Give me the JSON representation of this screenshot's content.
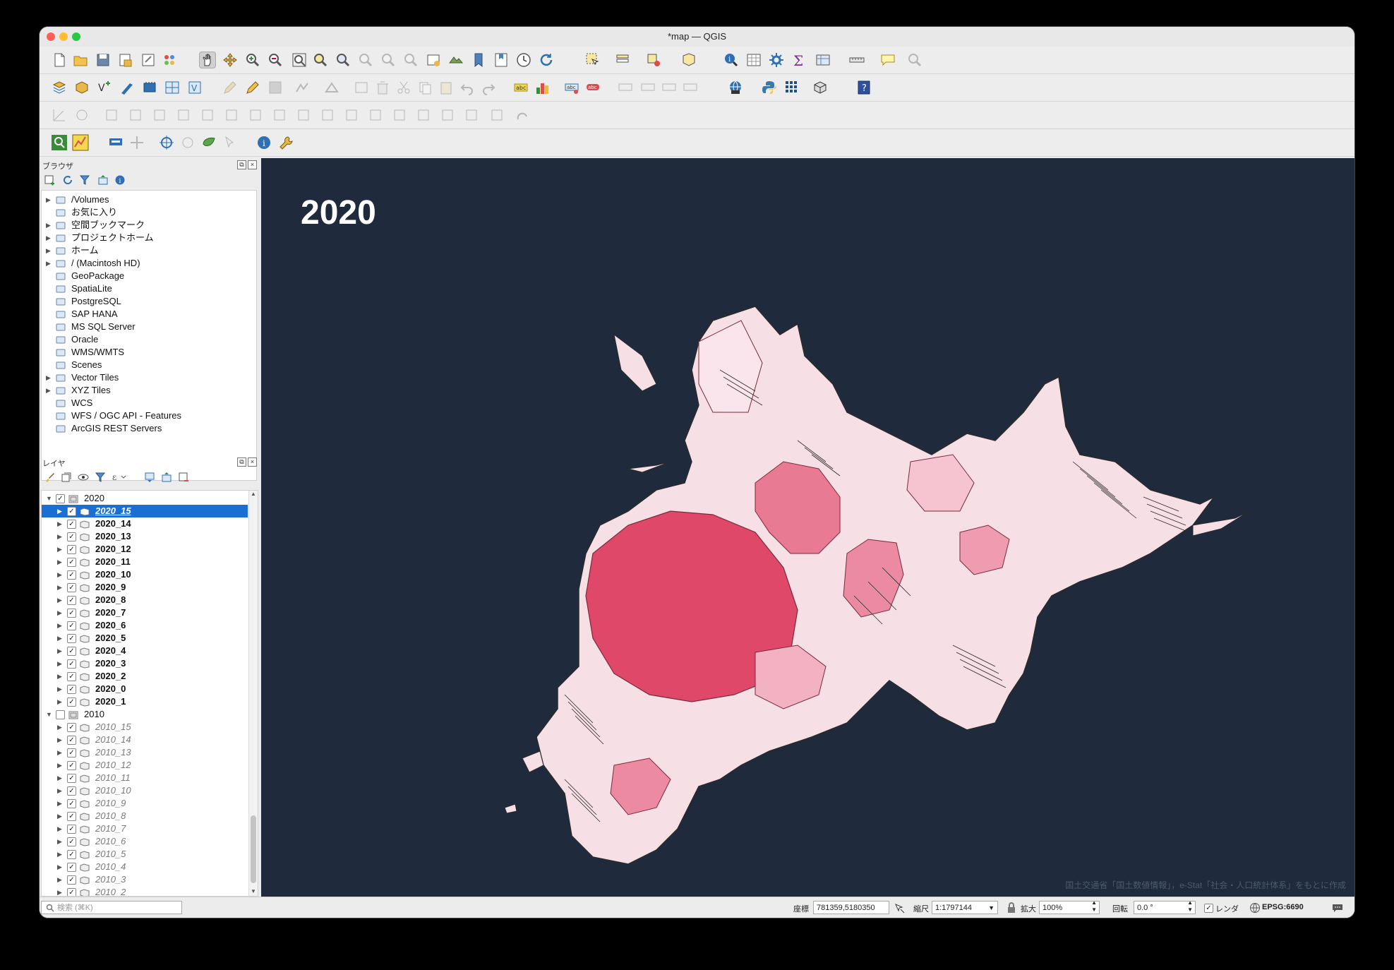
{
  "window": {
    "title": "*map — QGIS"
  },
  "browser": {
    "title": "ブラウザ",
    "items": [
      {
        "label": "/Volumes",
        "icon": "folder-icon",
        "expandable": true
      },
      {
        "label": "お気に入り",
        "icon": "star-icon",
        "expandable": false
      },
      {
        "label": "空間ブックマーク",
        "icon": "bookmark-icon",
        "expandable": true
      },
      {
        "label": "プロジェクトホーム",
        "icon": "project-home-icon",
        "expandable": true
      },
      {
        "label": "ホーム",
        "icon": "home-icon",
        "expandable": true
      },
      {
        "label": "/ (Macintosh HD)",
        "icon": "folder-icon",
        "expandable": true
      },
      {
        "label": "GeoPackage",
        "icon": "geopackage-icon",
        "expandable": false
      },
      {
        "label": "SpatiaLite",
        "icon": "spatialite-icon",
        "expandable": false
      },
      {
        "label": "PostgreSQL",
        "icon": "postgresql-icon",
        "expandable": false
      },
      {
        "label": "SAP HANA",
        "icon": "sap-hana-icon",
        "expandable": false
      },
      {
        "label": "MS SQL Server",
        "icon": "mssql-icon",
        "expandable": false
      },
      {
        "label": "Oracle",
        "icon": "oracle-icon",
        "expandable": false
      },
      {
        "label": "WMS/WMTS",
        "icon": "wms-icon",
        "expandable": false
      },
      {
        "label": "Scenes",
        "icon": "scenes-icon",
        "expandable": false
      },
      {
        "label": "Vector Tiles",
        "icon": "vector-tiles-icon",
        "expandable": true
      },
      {
        "label": "XYZ Tiles",
        "icon": "xyz-tiles-icon",
        "expandable": true
      },
      {
        "label": "WCS",
        "icon": "wcs-icon",
        "expandable": false
      },
      {
        "label": "WFS / OGC API - Features",
        "icon": "wfs-icon",
        "expandable": false
      },
      {
        "label": "ArcGIS REST Servers",
        "icon": "arcgis-icon",
        "expandable": false
      }
    ]
  },
  "layers": {
    "title": "レイヤ",
    "rows": [
      {
        "label": "2020",
        "type": "group",
        "checked": true
      },
      {
        "label": "2020_15",
        "type": "layer",
        "checked": true,
        "selected": true
      },
      {
        "label": "2020_14",
        "type": "layer",
        "checked": true
      },
      {
        "label": "2020_13",
        "type": "layer",
        "checked": true
      },
      {
        "label": "2020_12",
        "type": "layer",
        "checked": true
      },
      {
        "label": "2020_11",
        "type": "layer",
        "checked": true
      },
      {
        "label": "2020_10",
        "type": "layer",
        "checked": true
      },
      {
        "label": "2020_9",
        "type": "layer",
        "checked": true
      },
      {
        "label": "2020_8",
        "type": "layer",
        "checked": true
      },
      {
        "label": "2020_7",
        "type": "layer",
        "checked": true
      },
      {
        "label": "2020_6",
        "type": "layer",
        "checked": true
      },
      {
        "label": "2020_5",
        "type": "layer",
        "checked": true
      },
      {
        "label": "2020_4",
        "type": "layer",
        "checked": true
      },
      {
        "label": "2020_3",
        "type": "layer",
        "checked": true
      },
      {
        "label": "2020_2",
        "type": "layer",
        "checked": true
      },
      {
        "label": "2020_0",
        "type": "layer",
        "checked": true
      },
      {
        "label": "2020_1",
        "type": "layer",
        "checked": true
      },
      {
        "label": "2010",
        "type": "group",
        "checked": false
      },
      {
        "label": "2010_15",
        "type": "layer",
        "checked": true,
        "dimmed": true
      },
      {
        "label": "2010_14",
        "type": "layer",
        "checked": true,
        "dimmed": true
      },
      {
        "label": "2010_13",
        "type": "layer",
        "checked": true,
        "dimmed": true
      },
      {
        "label": "2010_12",
        "type": "layer",
        "checked": true,
        "dimmed": true
      },
      {
        "label": "2010_11",
        "type": "layer",
        "checked": true,
        "dimmed": true
      },
      {
        "label": "2010_10",
        "type": "layer",
        "checked": true,
        "dimmed": true
      },
      {
        "label": "2010_9",
        "type": "layer",
        "checked": true,
        "dimmed": true
      },
      {
        "label": "2010_8",
        "type": "layer",
        "checked": true,
        "dimmed": true
      },
      {
        "label": "2010_7",
        "type": "layer",
        "checked": true,
        "dimmed": true
      },
      {
        "label": "2010_6",
        "type": "layer",
        "checked": true,
        "dimmed": true
      },
      {
        "label": "2010_5",
        "type": "layer",
        "checked": true,
        "dimmed": true
      },
      {
        "label": "2010_4",
        "type": "layer",
        "checked": true,
        "dimmed": true
      },
      {
        "label": "2010_3",
        "type": "layer",
        "checked": true,
        "dimmed": true
      },
      {
        "label": "2010_2",
        "type": "layer",
        "checked": true,
        "dimmed": true
      }
    ]
  },
  "map": {
    "year_label": "2020",
    "credit": "国土交通省「国土数値情報」，e-Stat「社会・人口統計体系」をもとに作成",
    "background": "#1f2a3c",
    "fill_dark": "#e0486a",
    "fill_light": "#f7dfe6"
  },
  "status": {
    "search_placeholder": "検索 (⌘K)",
    "coord_label": "座標",
    "coord_value": "781359,5180350",
    "scale_label": "縮尺",
    "scale_value": "1:1797144",
    "magnifier_label": "拡大",
    "magnifier_value": "100%",
    "rotation_label": "回転",
    "rotation_value": "0.0 °",
    "render_label": "レンダ",
    "crs": "EPSG:6690"
  }
}
